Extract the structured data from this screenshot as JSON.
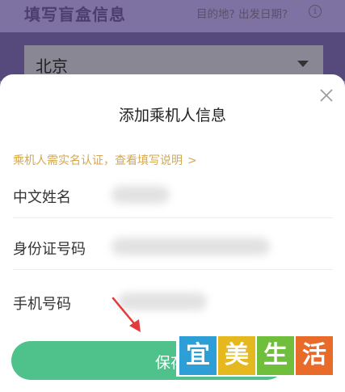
{
  "background": {
    "title": "填写盲盒信息",
    "hint": "目的地? 出发日期?",
    "info_icon": "i",
    "select_value": "北京"
  },
  "modal": {
    "title": "添加乘机人信息",
    "notice": "乘机人需实名认证，查看填写说明",
    "notice_chevron": ">",
    "fields": [
      {
        "label": "中文姓名"
      },
      {
        "label": "身份证号码"
      },
      {
        "label": "手机号码"
      }
    ],
    "save_label": "保存"
  },
  "watermark": {
    "chars": [
      "宜",
      "美",
      "生",
      "活"
    ]
  },
  "colors": {
    "save_button": "#4fc18a",
    "notice_text": "#d6a84b",
    "annotation_arrow": "#e23b3b"
  }
}
